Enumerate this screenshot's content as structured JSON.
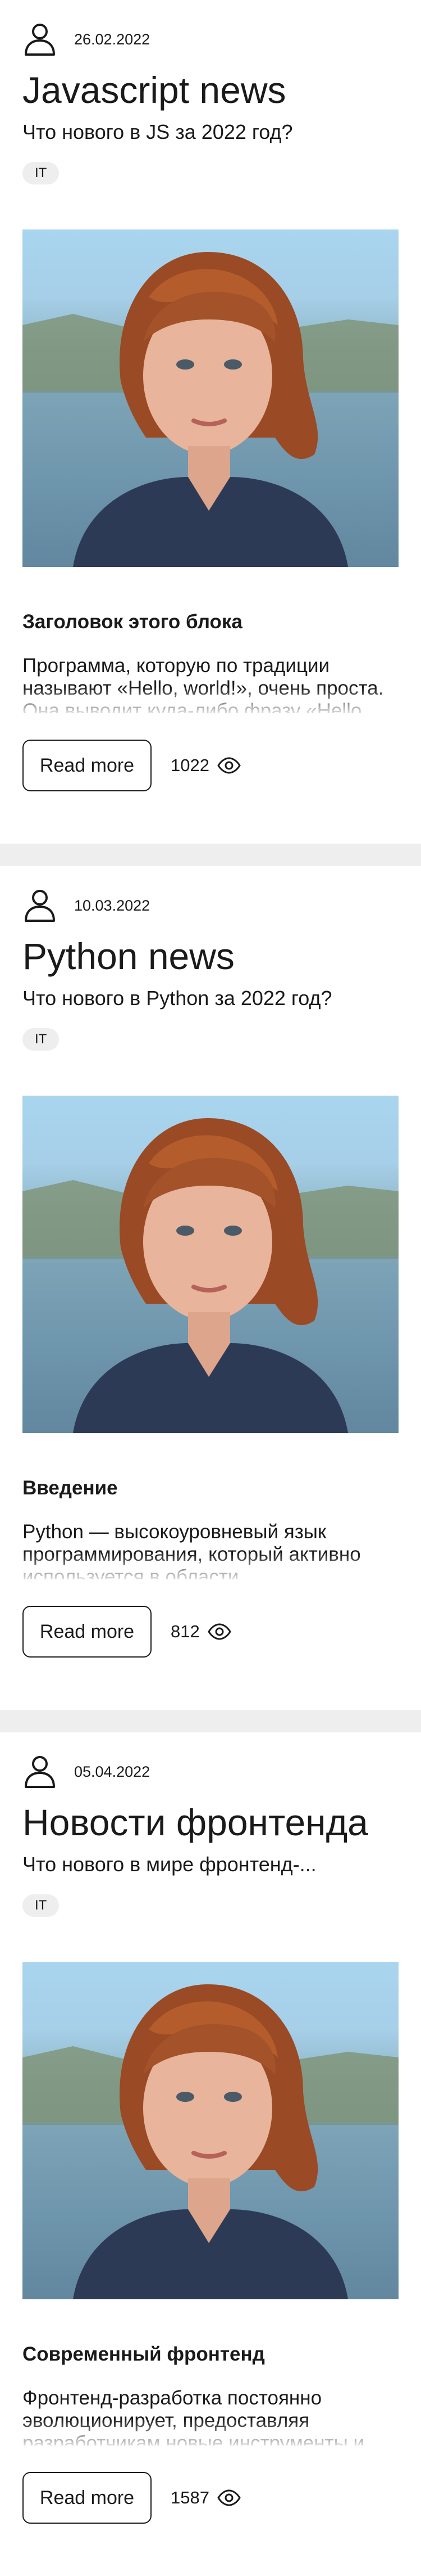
{
  "icons": {
    "avatar": "user-outline-icon",
    "views": "eye-icon"
  },
  "colors": {
    "separator": "#eeeeee",
    "tag_bg": "#eeeeee",
    "text": "#1a1a1a"
  },
  "cards": [
    {
      "date": "26.02.2022",
      "title": "Javascript news",
      "subtitle": "Что нового в JS за 2022 год?",
      "tag": "IT",
      "block_heading": "Заголовок этого блока",
      "excerpt": "Программа, которую по традиции называют «Hello, world!», очень проста. Она выводит куда-либо фразу «Hello, world!»",
      "read_more": "Read more",
      "views": "1022"
    },
    {
      "date": "10.03.2022",
      "title": "Python news",
      "subtitle": "Что нового в Python за 2022 год?",
      "tag": "IT",
      "block_heading": "Введение",
      "excerpt": "Python — высокоуровневый язык программирования, который активно используется в области",
      "read_more": "Read more",
      "views": "812"
    },
    {
      "date": "05.04.2022",
      "title": "Новости фронтенда",
      "subtitle": "Что нового в мире фронтенд-...",
      "tag": "IT",
      "block_heading": "Современный фронтенд",
      "excerpt": "Фронтенд-разработка постоянно эволюционирует, предоставляя разработчикам новые инструменты и",
      "read_more": "Read more",
      "views": "1587"
    }
  ]
}
